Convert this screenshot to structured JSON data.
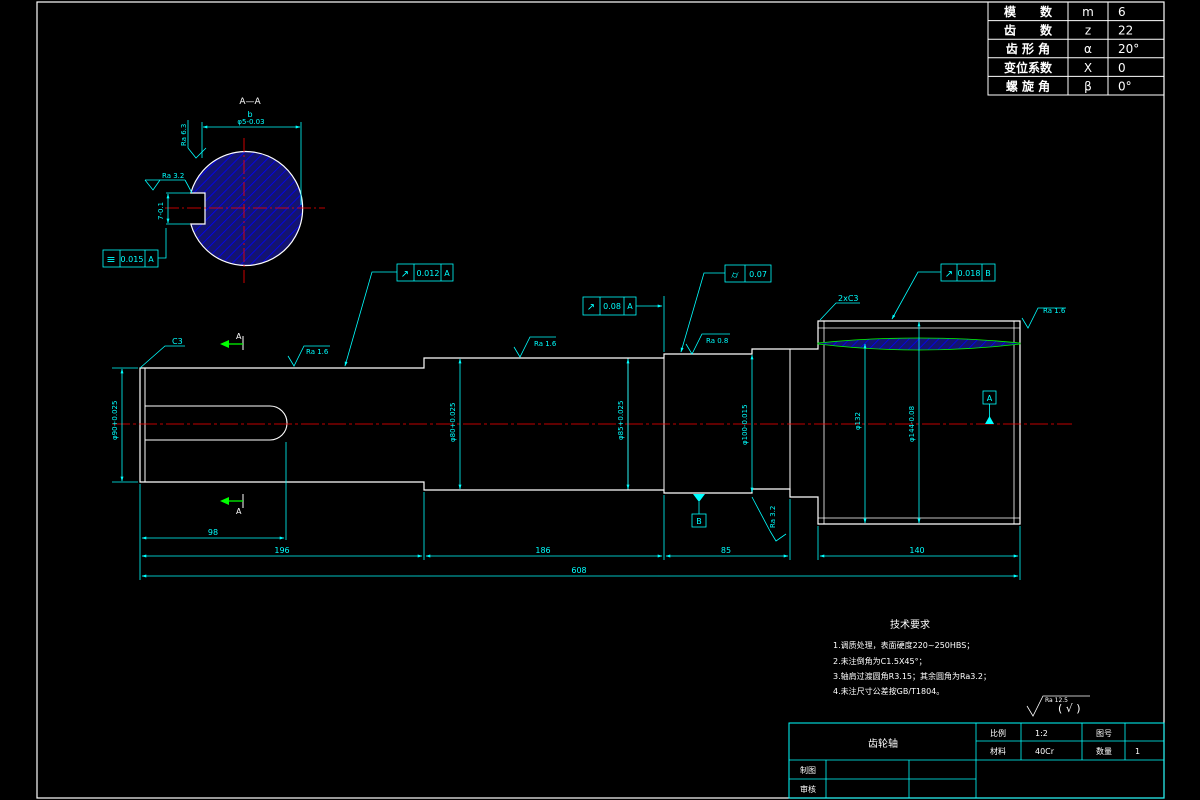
{
  "colors": {
    "background": "#000000",
    "outline": "#ffffff",
    "dimension": "#00ffff",
    "centerline": "#ff0000",
    "hatch_fill": "#141470",
    "hatch_line": "#0000ff",
    "datum_arrow": "#00ff00"
  },
  "gear_table": {
    "rows": [
      {
        "name": "模　　数",
        "symbol": "m",
        "value": "6"
      },
      {
        "name": "齿　　数",
        "symbol": "z",
        "value": "22"
      },
      {
        "name": "齿 形 角",
        "symbol": "α",
        "value": "20°"
      },
      {
        "name": "变位系数",
        "symbol": "X",
        "value": "0"
      },
      {
        "name": "螺 旋 角",
        "symbol": "β",
        "value": "0°"
      }
    ]
  },
  "section": {
    "title": "A—A",
    "width_dim": "b",
    "diameter_dim": "φ5-0.03",
    "depth_dim": "7-0.1",
    "roughness_top": "Ra 6.3",
    "roughness_left": "Ra 3.2",
    "symmetry_symbol": "≡",
    "symmetry_value": "0.015",
    "symmetry_datum": "A"
  },
  "shaft": {
    "chamfer_left": "C3",
    "chamfer_right": "2xC3",
    "section_label_top": "A",
    "section_label_bottom": "A",
    "dia_1": "φ90+0.025",
    "dia_2": "φ80+0.025",
    "dia_3": "φ85+0.025",
    "dia_4": "φ100-0.015",
    "dia_5": "φ132",
    "dia_6": "φ144-0.08",
    "tol_1": {
      "symbol": "↗",
      "value": "0.012",
      "datum": "A"
    },
    "tol_2": {
      "symbol": "↗",
      "value": "0.08",
      "datum": "A"
    },
    "tol_3": {
      "symbol": "⌭",
      "value": "0.07"
    },
    "tol_4": {
      "symbol": "↗",
      "value": "0.018",
      "datum": "B"
    },
    "ra_1": "Ra 1.6",
    "ra_2": "Ra 1.6",
    "ra_3": "Ra 0.8",
    "ra_4": "Ra 1.6",
    "ra_5": "Ra 3.2",
    "datum_a": "A",
    "datum_b": "B",
    "dim_keyway": "98",
    "dim_seg1": "196",
    "dim_seg2": "186",
    "dim_seg3": "85",
    "dim_seg4": "140",
    "dim_total": "608"
  },
  "tech_requirements": {
    "title": "技术要求",
    "items": [
      "1.调质处理，表面硬度220~250HBS；",
      "2.未注倒角为C1.5X45°；",
      "3.轴肩过渡圆角R3.15；其余圆角为Ra3.2；",
      "4.未注尺寸公差按GB/T1804。"
    ]
  },
  "general_roughness": {
    "symbol": "Ra 12.5",
    "paren": "( √ )"
  },
  "title_block": {
    "part_name": "齿轮轴",
    "label_scale": "比例",
    "value_scale": "1:2",
    "label_qty": "图号",
    "label_material": "材料",
    "value_material": "40Cr",
    "label_count": "数量",
    "value_count": "1",
    "label_drawn": "制图",
    "label_checked": "审核"
  }
}
